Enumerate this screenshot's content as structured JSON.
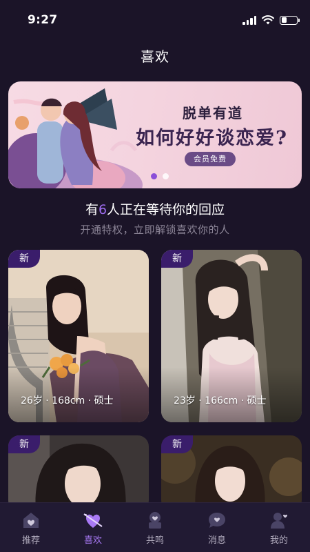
{
  "status": {
    "time": "9:27"
  },
  "header": {
    "title": "喜欢"
  },
  "banner": {
    "line1": "脱单有道",
    "line2": "如何好好谈恋爱?",
    "pill": "会员免费",
    "slides": 2,
    "active_slide": 1
  },
  "waiting": {
    "prefix": "有",
    "count": "6",
    "suffix": "人正在等待你的回应"
  },
  "subtitle": "开通特权，立即解锁喜欢你的人",
  "cards": [
    {
      "badge": "新",
      "info": "26岁 · 168cm · 硕士"
    },
    {
      "badge": "新",
      "info": "23岁 · 166cm · 硕士"
    },
    {
      "badge": "新",
      "info": ""
    },
    {
      "badge": "新",
      "info": ""
    }
  ],
  "tabs": [
    {
      "label": "推荐",
      "icon": "home-icon"
    },
    {
      "label": "喜欢",
      "icon": "heart-arrow-icon",
      "active": true
    },
    {
      "label": "共鸣",
      "icon": "resonance-icon"
    },
    {
      "label": "消息",
      "icon": "message-icon"
    },
    {
      "label": "我的",
      "icon": "profile-icon"
    }
  ],
  "colors": {
    "background": "#1b1428",
    "accent": "#a879f4",
    "badge": "#3a1d6b"
  }
}
